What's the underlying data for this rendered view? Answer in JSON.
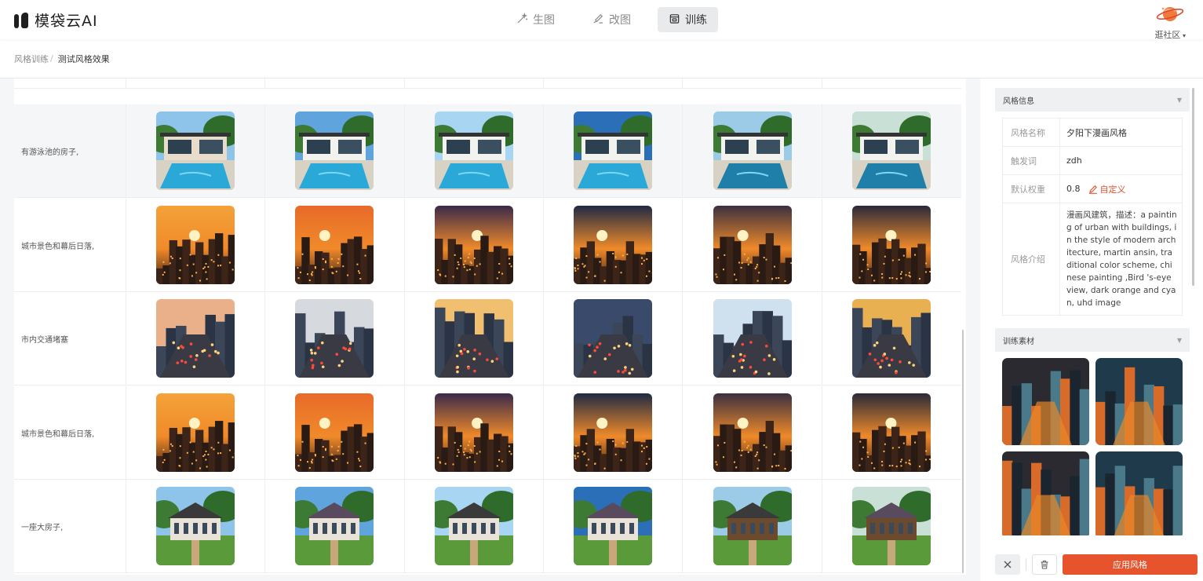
{
  "app": {
    "name": "模袋云AI"
  },
  "nav": {
    "items": [
      {
        "label": "生图",
        "icon": "magic-wand-icon"
      },
      {
        "label": "改图",
        "icon": "edit-brush-icon"
      },
      {
        "label": "训练",
        "icon": "training-box-icon",
        "active": true
      }
    ]
  },
  "community": {
    "label": "逛社区",
    "icon": "planet-icon"
  },
  "breadcrumb": {
    "parent": "风格训练",
    "separator": "/",
    "current": "测试风格效果"
  },
  "results": {
    "rows": [
      {
        "prompt": "",
        "scene": "house"
      },
      {
        "prompt": "有游泳池的房子,",
        "scene": "pool",
        "highlighted": true
      },
      {
        "prompt": "城市景色和幕后日落,",
        "scene": "sunset"
      },
      {
        "prompt": "市内交通堵塞",
        "scene": "traffic"
      },
      {
        "prompt": "城市景色和幕后日落,",
        "scene": "sunset2"
      },
      {
        "prompt": "一座大房子,",
        "scene": "mansion"
      }
    ],
    "columns": 6
  },
  "style_info": {
    "header": "风格信息",
    "fields": {
      "name_label": "风格名称",
      "name_value": "夕阳下漫画风格",
      "trigger_label": "触发词",
      "trigger_value": "zdh",
      "weight_label": "默认权重",
      "weight_value": "0.8",
      "custom_label": "自定义",
      "desc_label": "风格介绍",
      "desc_value": "漫画风建筑，描述：a painting of urban with buildings, in the style of modern architecture, martin ansin, traditional color scheme, chinese painting ,Bird 's-eye view, dark orange and cyan, uhd image"
    }
  },
  "materials": {
    "header": "训练素材",
    "count": 4
  },
  "actions": {
    "close_icon": "close-icon",
    "delete_icon": "trash-icon",
    "apply_label": "应用风格"
  },
  "colors": {
    "accent": "#e6532c",
    "link": "#e0502b"
  }
}
